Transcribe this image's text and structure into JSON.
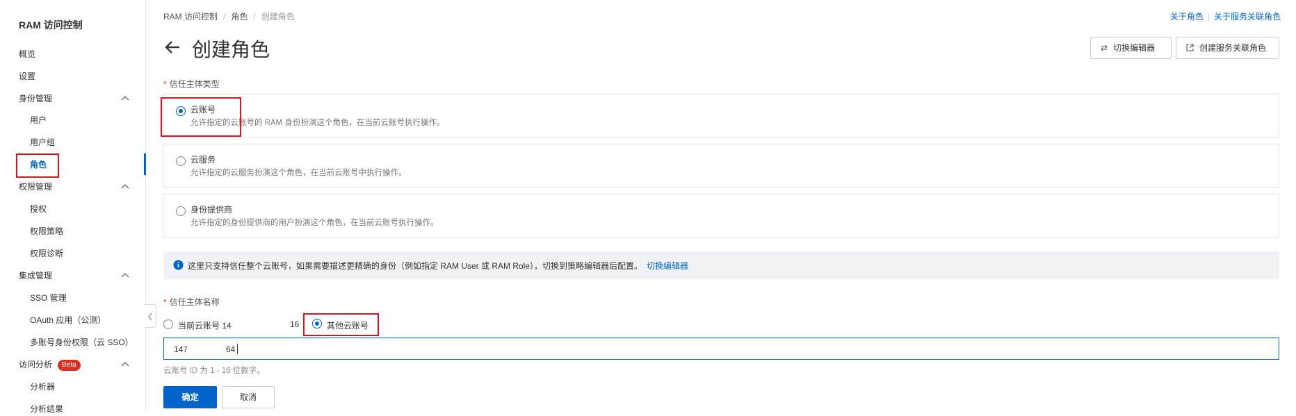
{
  "sidebar": {
    "title": "RAM 访问控制",
    "items": [
      {
        "label": "概览"
      },
      {
        "label": "设置"
      },
      {
        "label": "身份管理"
      },
      {
        "label": "用户"
      },
      {
        "label": "用户组"
      },
      {
        "label": "角色"
      },
      {
        "label": "权限管理"
      },
      {
        "label": "授权"
      },
      {
        "label": "权限策略"
      },
      {
        "label": "权限诊断"
      },
      {
        "label": "集成管理"
      },
      {
        "label": "SSO 管理"
      },
      {
        "label": "OAuth 应用（公测）"
      },
      {
        "label": "多账号身份权限（云 SSO）"
      },
      {
        "label": "访问分析"
      },
      {
        "label": "分析器"
      },
      {
        "label": "分析结果"
      }
    ],
    "beta_badge": "Beta"
  },
  "breadcrumb": [
    "RAM 访问控制",
    "角色",
    "创建角色"
  ],
  "top_links": {
    "about_role": "关于角色",
    "about_service_role": "关于服务关联角色"
  },
  "page": {
    "title": "创建角色"
  },
  "toolbar": {
    "switch_editor": "切换编辑器",
    "create_service_role": "创建服务关联角色"
  },
  "trust_type": {
    "label": "信任主体类型",
    "options": [
      {
        "title": "云账号",
        "desc": "允许指定的云账号的 RAM 身份扮演这个角色，在当前云账号执行操作。",
        "checked": true
      },
      {
        "title": "云服务",
        "desc": "允许指定的云服务扮演这个角色，在当前云账号中执行操作。",
        "checked": false
      },
      {
        "title": "身份提供商",
        "desc": "允许指定的身份提供商的用户扮演这个角色，在当前云账号执行操作。",
        "checked": false
      }
    ]
  },
  "info": {
    "text": "这里只支持信任整个云账号，如果需要描述更精确的身份（例如指定 RAM User 或 RAM Role），切换到策略编辑器后配置。",
    "link": "切换编辑器"
  },
  "trust_name": {
    "label": "信任主体名称",
    "current_account_label": "当前云账号 14",
    "current_account_suffix": "16",
    "other_account_label": "其他云账号",
    "input_value": "147",
    "input_value_suffix": "64",
    "hint": "云账号 ID 为 1 - 16 位数字。"
  },
  "actions": {
    "confirm": "确定",
    "cancel": "取消"
  },
  "colors": {
    "accent": "#0064c8",
    "annotation_box": "#e0101e",
    "beta": "#d93026",
    "info_bg": "#f0f2f5"
  }
}
